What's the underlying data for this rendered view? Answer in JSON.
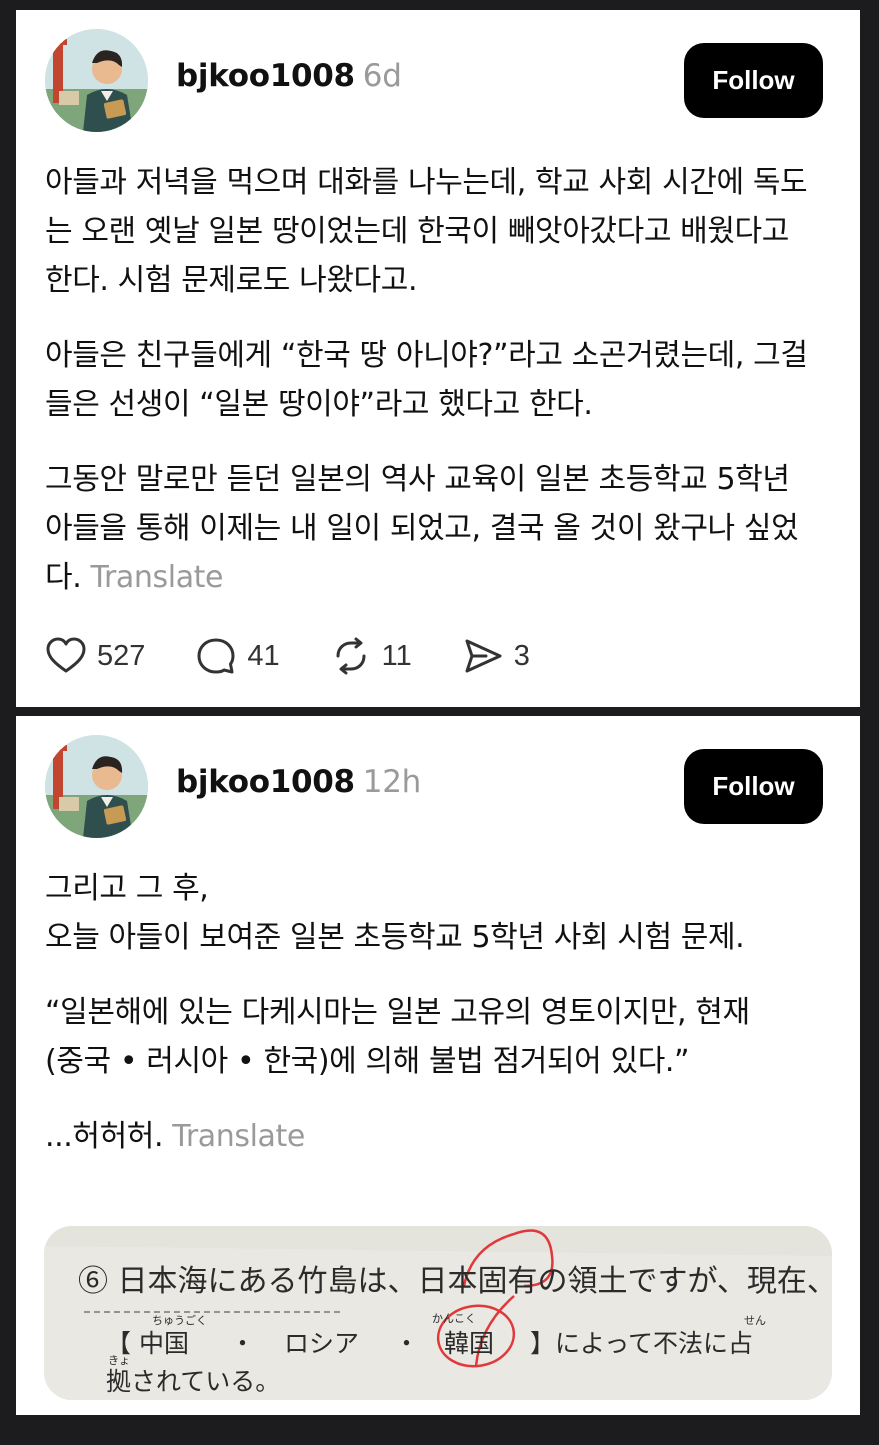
{
  "posts": [
    {
      "username": "bjkoo1008",
      "time": "6d",
      "follow_label": "Follow",
      "paragraphs": [
        "아들과 저녁을 먹으며 대화를 나누는데, 학교 사회 시간에 독도는 오랜 옛날 일본 땅이었는데 한국이 빼앗아갔다고 배웠다고 한다. 시험 문제로도 나왔다고.",
        "아들은 친구들에게 “한국 땅 아니야?”라고 소곤거렸는데, 그걸 들은 선생이 “일본 땅이야”라고 했다고 한다.",
        "그동안 말로만 듣던 일본의 역사 교육이 일본 초등학교 5학년 아들을 통해 이제는 내 일이 되었고, 결국 올 것이 왔구나 싶었다."
      ],
      "translate_label": "Translate",
      "likes": "527",
      "comments": "41",
      "reposts": "11",
      "shares": "3"
    },
    {
      "username": "bjkoo1008",
      "time": "12h",
      "follow_label": "Follow",
      "paragraph_1_line_1": "그리고 그 후,",
      "paragraph_1_line_2": "오늘 아들이 보여준 일본 초등학교 5학년 사회 시험 문제.",
      "paragraph_2": "“일본해에 있는 다케시마는 일본 고유의 영토이지만, 현재 (중국 • 러시아 • 한국)에 의해 불법 점거되어 있다.”",
      "paragraph_3": "...허허허.",
      "translate_label": "Translate",
      "exam_image": {
        "line_1": "⑥ 日本海にある竹島は、日本固有の領土ですが、現在、",
        "option_1": "【 中国",
        "option_2": "ロシア",
        "option_3": "韓国",
        "line_2_tail": "】によって不法に占",
        "line_3": "拠されている。",
        "ruby_1": "ちゅうごく",
        "ruby_2": "かんこく",
        "ruby_3": "せん",
        "ruby_4": "きょ"
      }
    }
  ],
  "colors": {
    "background": "#1c1c1e",
    "card": "#ffffff",
    "follow_button": "#000000",
    "muted_text": "#9a9a9a",
    "red_circle": "#e0383b"
  },
  "icons": [
    "heart-icon",
    "comment-icon",
    "repost-icon",
    "share-icon"
  ]
}
